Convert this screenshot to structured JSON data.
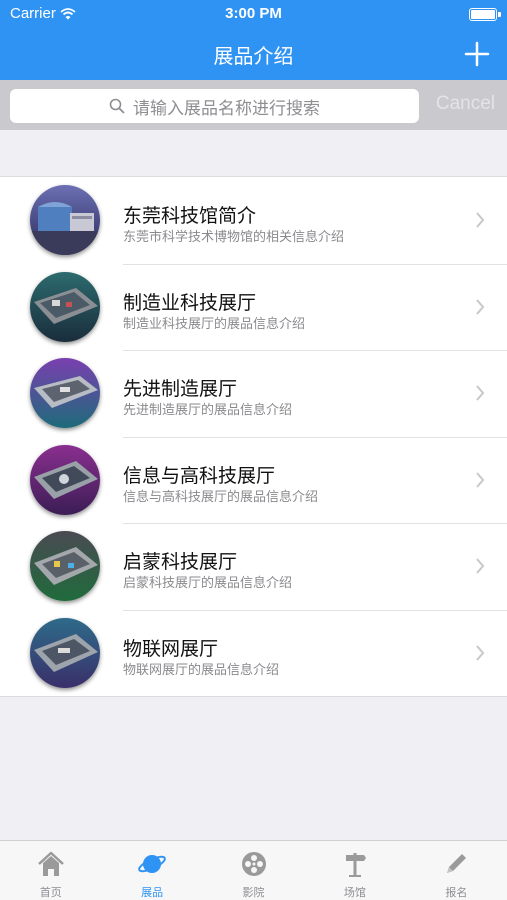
{
  "status_bar": {
    "carrier": "Carrier",
    "time": "3:00 PM"
  },
  "nav": {
    "title": "展品介绍"
  },
  "search": {
    "placeholder": "请输入展品名称进行搜索",
    "cancel_label": "Cancel"
  },
  "items": [
    {
      "title": "东莞科技馆简介",
      "subtitle": "东莞市科学技术博物馆的相关信息介绍"
    },
    {
      "title": "制造业科技展厅",
      "subtitle": "制造业科技展厅的展品信息介绍"
    },
    {
      "title": "先进制造展厅",
      "subtitle": "先进制造展厅的展品信息介绍"
    },
    {
      "title": "信息与高科技展厅",
      "subtitle": "信息与高科技展厅的展品信息介绍"
    },
    {
      "title": "启蒙科技展厅",
      "subtitle": "启蒙科技展厅的展品信息介绍"
    },
    {
      "title": "物联网展厅",
      "subtitle": "物联网展厅的展品信息介绍"
    }
  ],
  "tabs": [
    {
      "label": "首页",
      "icon": "home-icon"
    },
    {
      "label": "展品",
      "icon": "planet-icon",
      "active": true
    },
    {
      "label": "影院",
      "icon": "film-reel-icon"
    },
    {
      "label": "场馆",
      "icon": "signpost-icon"
    },
    {
      "label": "报名",
      "icon": "pencil-icon"
    }
  ],
  "colors": {
    "primary": "#2f93f4",
    "tab_inactive": "#8e8e93",
    "tab_icon_inactive": "#9a9a9a"
  }
}
